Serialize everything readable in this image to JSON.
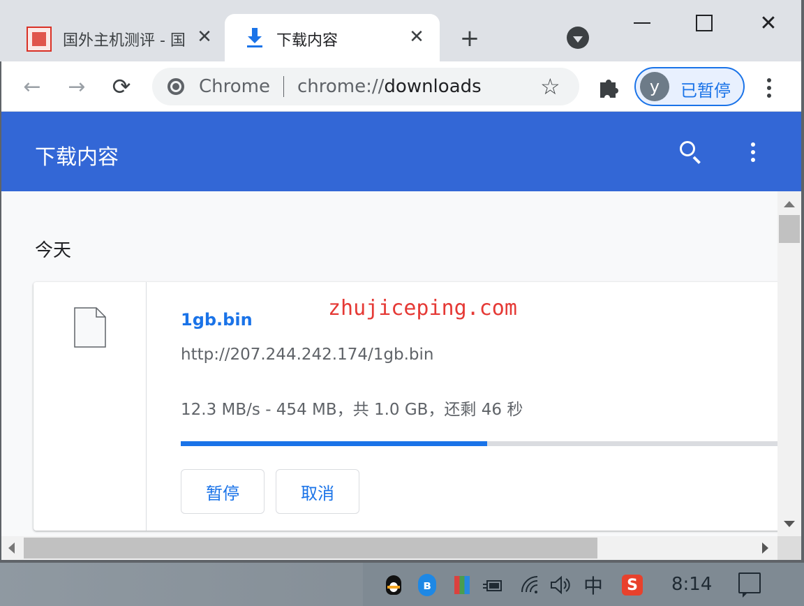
{
  "tabs": [
    {
      "title": "国外主机测评 - 国",
      "favicon": "site-logo-icon",
      "close": "✕",
      "active": false
    },
    {
      "title": "下载内容",
      "favicon": "download-icon",
      "close": "✕",
      "active": true
    }
  ],
  "tabstrip": {
    "new_tab": "+",
    "close_glyph": "✕"
  },
  "toolbar": {
    "omnibox": {
      "site_label": "Chrome",
      "url_scheme": "chrome://",
      "url_path": "downloads"
    },
    "profile": {
      "initial": "y",
      "label": "已暂停"
    }
  },
  "downloads": {
    "title": "下载内容",
    "date_header": "今天",
    "item": {
      "file_name": "1gb.bin",
      "url": "http://207.244.242.174/1gb.bin",
      "status": "12.3 MB/s - 454 MB，共 1.0 GB，还剩 46 秒",
      "progress": 0.499,
      "pause_label": "暂停",
      "cancel_label": "取消"
    }
  },
  "watermark": "zhujiceping.com",
  "taskbar": {
    "ime": "中",
    "sogou": "S",
    "bluetooth": "ʙ",
    "clock": "8:14"
  },
  "colors": {
    "header_blue": "#3367d6",
    "link_blue": "#1a73e8",
    "watermark_red": "#e53935"
  }
}
